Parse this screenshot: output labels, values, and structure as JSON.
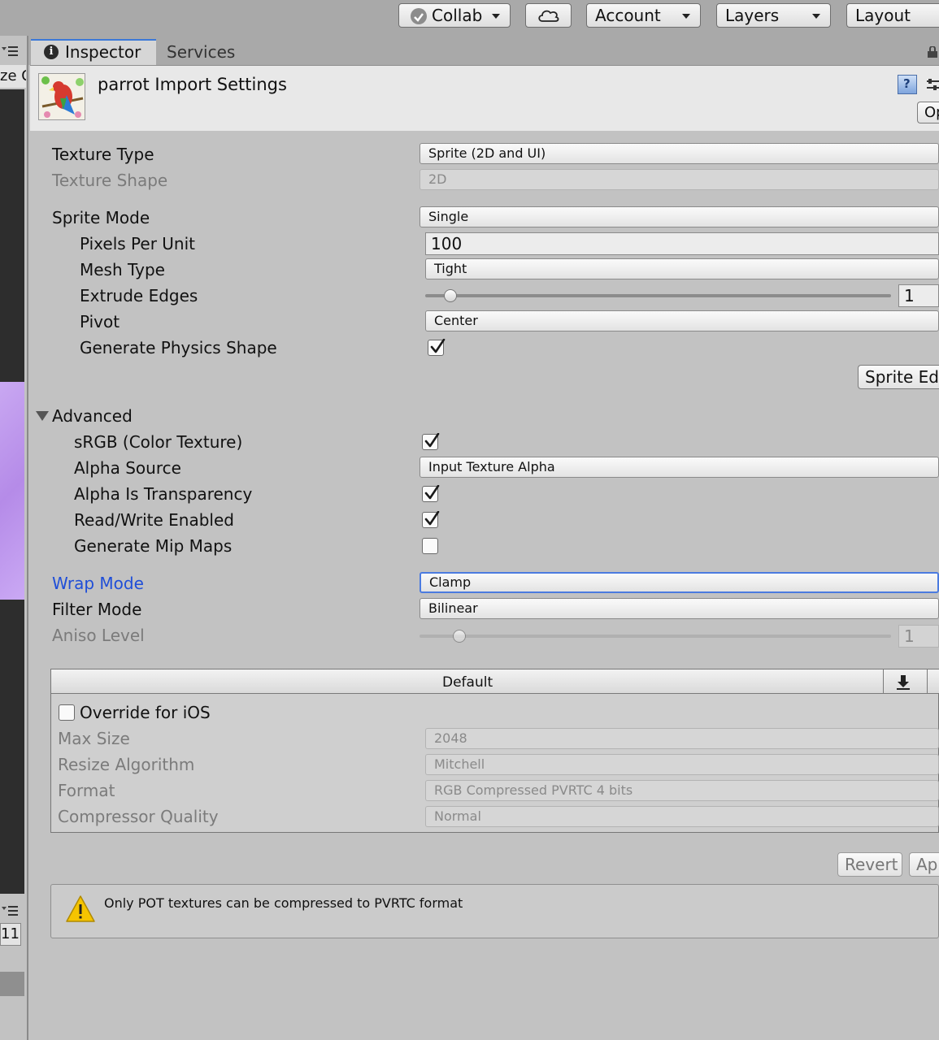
{
  "toolbar": {
    "collab_label": "Collab",
    "account_label": "Account",
    "layers_label": "Layers",
    "layout_label": "Layout"
  },
  "left_panel": {
    "top_text": "ze O",
    "bottom_text": "11"
  },
  "tabs": {
    "inspector": "Inspector",
    "services": "Services"
  },
  "header": {
    "title": "parrot Import Settings",
    "open_button": "Op"
  },
  "texture": {
    "texture_type_label": "Texture Type",
    "texture_type_value": "Sprite (2D and UI)",
    "texture_shape_label": "Texture Shape",
    "texture_shape_value": "2D"
  },
  "sprite": {
    "sprite_mode_label": "Sprite Mode",
    "sprite_mode_value": "Single",
    "pixels_per_unit_label": "Pixels Per Unit",
    "pixels_per_unit_value": "100",
    "mesh_type_label": "Mesh Type",
    "mesh_type_value": "Tight",
    "extrude_edges_label": "Extrude Edges",
    "extrude_edges_value": "1",
    "extrude_edges_slider_fraction": 0.04,
    "pivot_label": "Pivot",
    "pivot_value": "Center",
    "generate_physics_label": "Generate Physics Shape",
    "generate_physics_checked": true,
    "sprite_editor_button": "Sprite Edi"
  },
  "advanced": {
    "section_label": "Advanced",
    "srgb_label": "sRGB (Color Texture)",
    "srgb_checked": true,
    "alpha_source_label": "Alpha Source",
    "alpha_source_value": "Input Texture Alpha",
    "alpha_transparency_label": "Alpha Is Transparency",
    "alpha_transparency_checked": true,
    "read_write_label": "Read/Write Enabled",
    "read_write_checked": true,
    "mipmaps_label": "Generate Mip Maps",
    "mipmaps_checked": false
  },
  "wrap": {
    "wrap_mode_label": "Wrap Mode",
    "wrap_mode_value": "Clamp",
    "filter_mode_label": "Filter Mode",
    "filter_mode_value": "Bilinear",
    "aniso_level_label": "Aniso Level",
    "aniso_level_value": "1",
    "aniso_slider_fraction": 0.07
  },
  "platform": {
    "default_tab": "Default",
    "override_label": "Override for iOS",
    "override_checked": false,
    "max_size_label": "Max Size",
    "max_size_value": "2048",
    "resize_label": "Resize Algorithm",
    "resize_value": "Mitchell",
    "format_label": "Format",
    "format_value": "RGB Compressed PVRTC 4 bits",
    "compressor_label": "Compressor Quality",
    "compressor_value": "Normal"
  },
  "actions": {
    "revert": "Revert",
    "apply": "Ap"
  },
  "warning": {
    "text": "Only POT textures can be compressed to PVRTC format"
  },
  "colors": {
    "accent_blue": "#1f4ed8",
    "focus_blue": "#4b7be0",
    "warning_yellow": "#f5c400"
  }
}
